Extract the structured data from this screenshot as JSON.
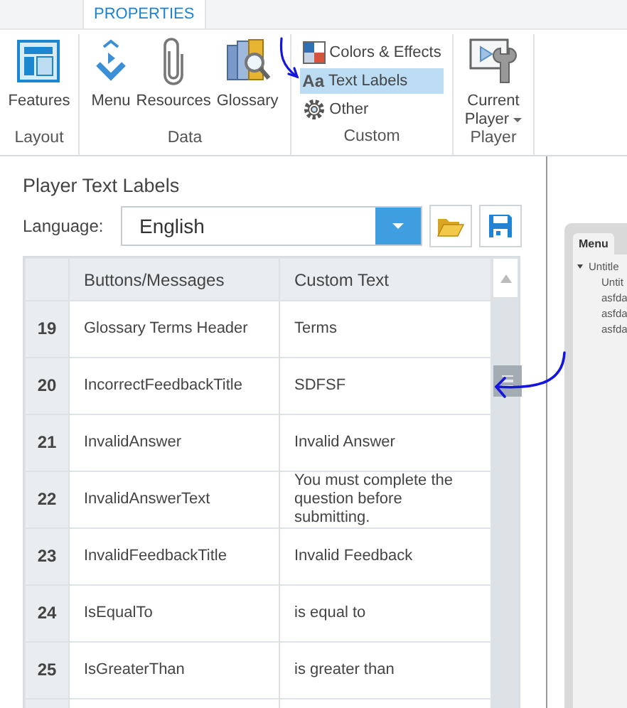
{
  "tabs": [
    {
      "label": "PROPERTIES",
      "selected": true
    }
  ],
  "ribbon_groups": [
    {
      "label": "Layout",
      "items": [
        {
          "kind": "large",
          "label": "Features"
        }
      ]
    },
    {
      "label": "Data",
      "items": [
        {
          "kind": "large",
          "label": "Menu"
        },
        {
          "kind": "large",
          "label": "Resources"
        },
        {
          "kind": "large",
          "label": "Glossary"
        }
      ]
    },
    {
      "label": "Custom",
      "items": [
        {
          "kind": "small",
          "label": "Colors & Effects",
          "selected": false
        },
        {
          "kind": "small",
          "glyph": "Aa",
          "label": "Text Labels",
          "selected": true
        },
        {
          "kind": "small",
          "label": "Other",
          "selected": false
        }
      ]
    },
    {
      "label": "Player",
      "items": [
        {
          "kind": "large",
          "label": "Current",
          "label_2": "Player",
          "dropdown": true
        }
      ]
    }
  ],
  "panel": {
    "title": "Player Text Labels",
    "language_label": "Language:",
    "language": "English",
    "table": {
      "columns": [
        "Buttons/Messages",
        "Custom Text"
      ],
      "rows": [
        {
          "number": "19",
          "name": "Glossary Terms Header",
          "text": "Terms"
        },
        {
          "number": "20",
          "name": "IncorrectFeedbackTitle",
          "text": "SDFSF"
        },
        {
          "number": "21",
          "name": "InvalidAnswer",
          "text": "Invalid Answer"
        },
        {
          "number": "22",
          "name": "InvalidAnswerText",
          "text": "You must complete the question before submitting."
        },
        {
          "number": "23",
          "name": "InvalidFeedbackTitle",
          "text": "Invalid Feedback"
        },
        {
          "number": "24",
          "name": "IsEqualTo",
          "text": "is equal to"
        },
        {
          "number": "25",
          "name": "IsGreaterThan",
          "text": "is greater than"
        }
      ]
    }
  },
  "preview": {
    "tab": "Menu",
    "tree": [
      {
        "label": "Untitle",
        "expanded": true,
        "children": [
          {
            "label": "Untit"
          },
          {
            "label": "asfda"
          },
          {
            "label": "asfda"
          },
          {
            "label": "asfda"
          }
        ]
      }
    ]
  }
}
